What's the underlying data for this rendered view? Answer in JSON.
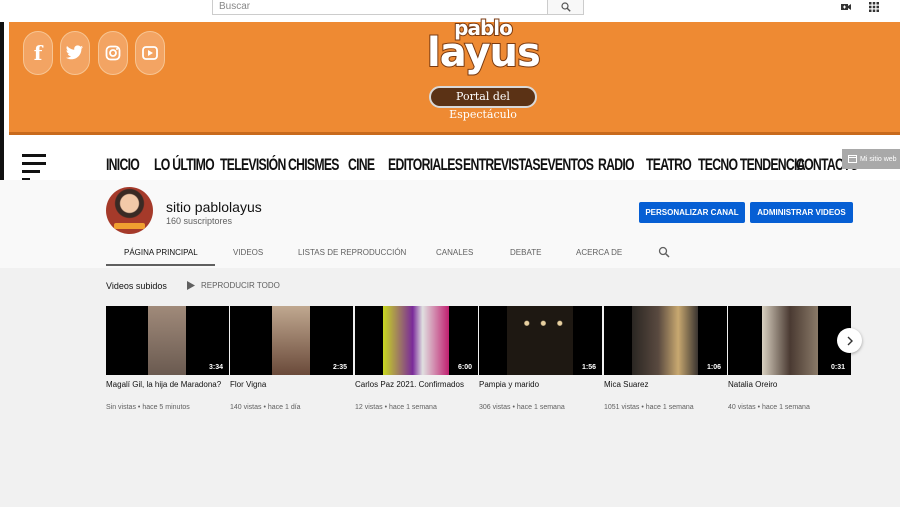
{
  "topbar": {
    "search_placeholder": "Buscar",
    "icons": [
      "search-icon",
      "video-camera-icon",
      "apps-grid-icon"
    ]
  },
  "banner": {
    "social_icons": [
      "facebook-icon",
      "twitter-icon",
      "instagram-icon",
      "youtube-icon"
    ],
    "logo_top": "pablo",
    "logo_main": "layus",
    "logo_tagline": "Portal del Espectáculo",
    "nav": [
      "INICIO",
      "LO ÚLTIMO",
      "TELEVISIÓN",
      "CHISMES",
      "CINE",
      "EDITORIALES",
      "ENTREVISTAS",
      "EVENTOS",
      "RADIO",
      "TEATRO",
      "TECNO TENDENCIA",
      "CONTACTO"
    ],
    "mini_site_label": "Mi sitio web"
  },
  "channel": {
    "name": "sitio pablolayus",
    "subscribers": "160 suscriptores",
    "customize_label": "PERSONALIZAR CANAL",
    "manage_label": "ADMINISTRAR VIDEOS",
    "tabs": [
      "PÁGINA PRINCIPAL",
      "VIDEOS",
      "LISTAS DE REPRODUCCIÓN",
      "CANALES",
      "DEBATE",
      "ACERCA DE"
    ],
    "active_tab": "PÁGINA PRINCIPAL"
  },
  "section": {
    "title": "Videos subidos",
    "play_all": "REPRODUCIR TODO"
  },
  "videos": [
    {
      "title": "Magalí Gil, la hija de Maradona?",
      "duration": "3:34",
      "views": "Sin vistas",
      "age": "hace 5 minutos",
      "color": "#8a7060"
    },
    {
      "title": "Flor Vigna",
      "duration": "2:35",
      "views": "140 vistas",
      "age": "hace 1 día",
      "color": "#a88a70"
    },
    {
      "title": "Carlos Paz 2021. Confirmados",
      "duration": "6:00",
      "views": "12 vistas",
      "age": "hace 1 semana",
      "color": "#7a8a2a"
    },
    {
      "title": "Pampia y marido",
      "duration": "1:56",
      "views": "306 vistas",
      "age": "hace 1 semana",
      "color": "#1a1410"
    },
    {
      "title": "Mica Suarez",
      "duration": "1:06",
      "views": "1051 vistas",
      "age": "hace 1 semana",
      "color": "#3a3632"
    },
    {
      "title": "Natalia Oreiro",
      "duration": "0:31",
      "views": "40 vistas",
      "age": "hace 1 semana",
      "color": "#6a5448"
    }
  ],
  "colors": {
    "banner_orange": "#ee8a33",
    "button_blue": "#065fd4"
  }
}
